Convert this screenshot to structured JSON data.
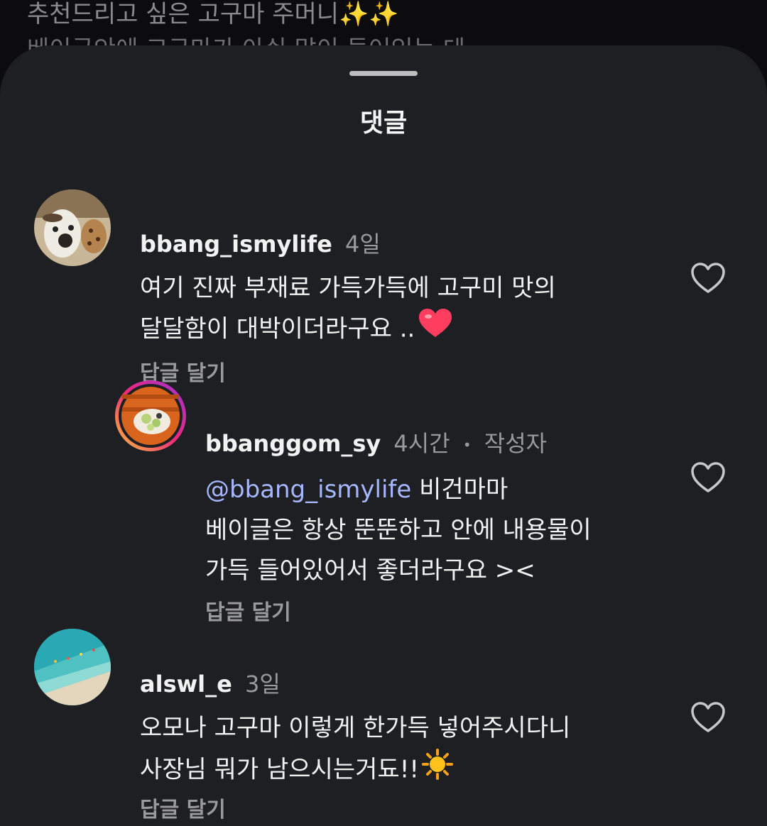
{
  "background_post": {
    "line1": "추천드리고 싶은 고구마 주머니✨✨",
    "line2": "베이글안에 고구마가 아쉬 많이 들어있는 데"
  },
  "sheet": {
    "title": "댓글"
  },
  "comments": [
    {
      "username": "bbang_ismylife",
      "time": "4일",
      "lines": [
        "여기 진짜 부재료 가득가득에 고구미 맛의",
        "달달함이 대박이더라구요 .."
      ],
      "emoji": "heart",
      "reply_label": "답글 달기",
      "icon": "heart-icon"
    },
    {
      "username": "bbanggom_sy",
      "time": "4시간",
      "separator": "•",
      "author_badge": "작성자",
      "mention": "@bbang_ismylife",
      "lines": [
        "비건마마",
        "베이글은 항상 뚠뚠하고 안에 내용물이",
        "가득 들어있어서 좋더라구요 ><"
      ],
      "reply_label": "답글 달기",
      "icon": "heart-icon"
    },
    {
      "username": "alswl_e",
      "time": "3일",
      "lines": [
        "오모나 고구마 이렇게 한가득 넣어주시다니",
        "사장님 뭐가 남으시는거됴!!"
      ],
      "emoji": "sun",
      "reply_label": "답글 달기",
      "icon": "heart-icon"
    }
  ],
  "colors": {
    "sheet_bg": "#1d1f22",
    "muted": "#9a9a9e",
    "mention": "#a7b7ff"
  }
}
